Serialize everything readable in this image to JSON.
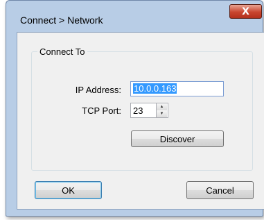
{
  "window": {
    "title": "Connect > Network",
    "close_glyph": "X"
  },
  "group": {
    "label": "Connect To"
  },
  "fields": {
    "ip_label": "IP Address:",
    "ip_value": "10.0.0.163",
    "port_label": "TCP Port:",
    "port_value": "23"
  },
  "buttons": {
    "discover": "Discover",
    "ok": "OK",
    "cancel": "Cancel"
  },
  "icons": {
    "spin_up": "triangle-up",
    "spin_down": "triangle-down"
  }
}
